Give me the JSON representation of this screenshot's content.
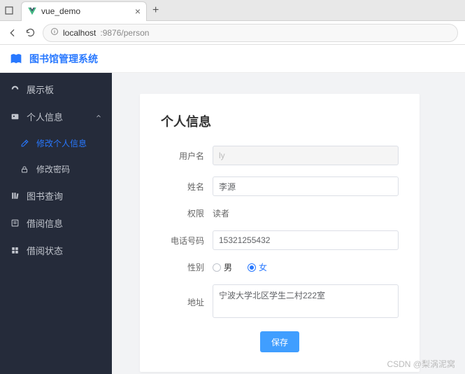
{
  "browser": {
    "tab_title": "vue_demo",
    "url_host": "localhost",
    "url_port_path": ":9876/person",
    "close_glyph": "×",
    "newtab_glyph": "+"
  },
  "header": {
    "app_title": "图书馆管理系统"
  },
  "sidebar": {
    "items": [
      {
        "icon": "dashboard-icon",
        "label": "展示板"
      },
      {
        "icon": "id-card-icon",
        "label": "个人信息",
        "expanded": true
      },
      {
        "icon": "edit-icon",
        "label": "修改个人信息",
        "sub": true,
        "active": true
      },
      {
        "icon": "lock-icon",
        "label": "修改密码",
        "sub": true
      },
      {
        "icon": "books-icon",
        "label": "图书查询"
      },
      {
        "icon": "list-icon",
        "label": "借阅信息"
      },
      {
        "icon": "grid-icon",
        "label": "借阅状态"
      }
    ]
  },
  "form": {
    "title": "个人信息",
    "labels": {
      "username": "用户名",
      "name": "姓名",
      "role": "权限",
      "phone": "电话号码",
      "gender": "性别",
      "address": "地址"
    },
    "values": {
      "username": "ly",
      "name": "李源",
      "role": "读者",
      "phone": "15321255432",
      "address": "宁波大学北区学生二村222室"
    },
    "gender_options": {
      "male": "男",
      "female": "女"
    },
    "gender_selected": "female",
    "save_label": "保存"
  },
  "watermark": "CSDN @梨涡泥窝"
}
